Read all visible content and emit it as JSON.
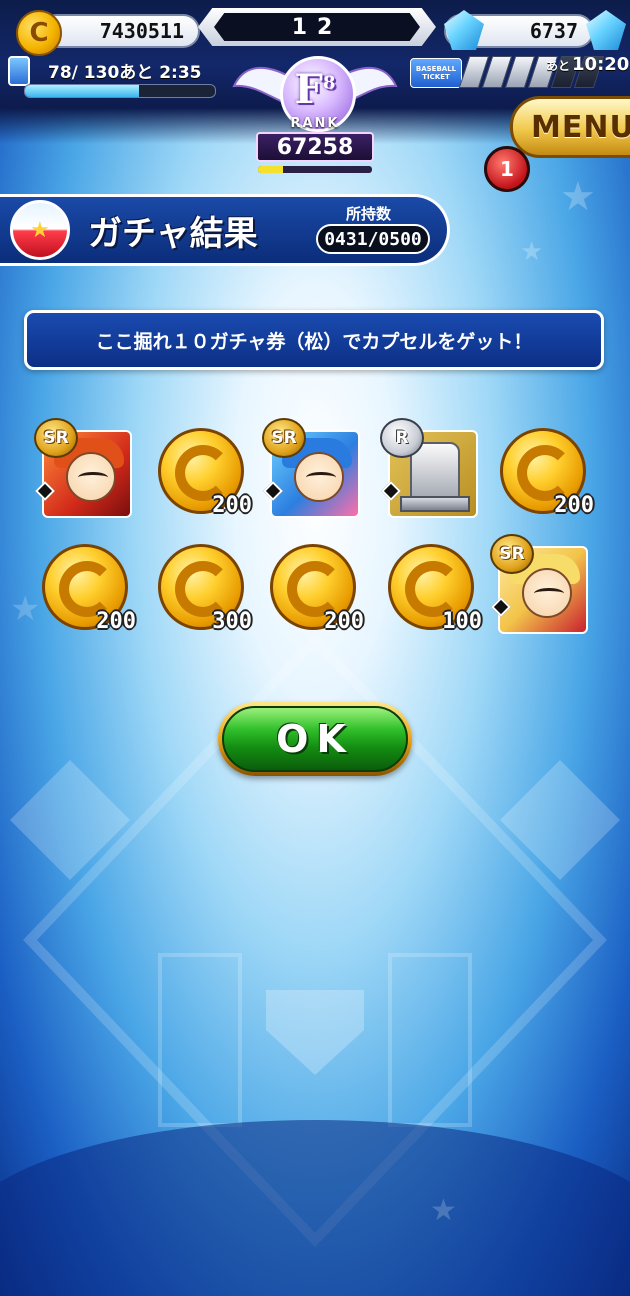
{
  "header": {
    "coins": "7430511",
    "level": "12",
    "gems": "6737",
    "stamina_text": "78/ 130あと 2:35",
    "stamina_fraction": 0.6,
    "ticket_label": "BASEBALL TICKET",
    "ticket_slots_filled": 4,
    "ticket_slots_total": 6,
    "ticket_prefix": "あと",
    "ticket_time": "10:20",
    "rank_letter": "F",
    "rank_sub": "8",
    "rank_word": "RANK",
    "rank_value": "67258",
    "rank_progress": 0.22,
    "menu_label": "MENU",
    "notification_count": "1"
  },
  "title_banner": {
    "title": "ガチャ結果",
    "owned_label": "所持数",
    "owned_value": "0431/0500"
  },
  "message": "ここ掘れ１０ガチャ券（松）でカプセルをゲット！",
  "results": [
    {
      "kind": "card",
      "rarity": "SR",
      "style": "red"
    },
    {
      "kind": "coin",
      "amount": "200"
    },
    {
      "kind": "card",
      "rarity": "SR",
      "style": "blue"
    },
    {
      "kind": "card",
      "rarity": "R",
      "style": "silver"
    },
    {
      "kind": "coin",
      "amount": "200"
    },
    {
      "kind": "coin",
      "amount": "200"
    },
    {
      "kind": "coin",
      "amount": "300"
    },
    {
      "kind": "coin",
      "amount": "200"
    },
    {
      "kind": "coin",
      "amount": "100"
    },
    {
      "kind": "card",
      "rarity": "SR",
      "style": "yellow"
    }
  ],
  "ok_label": "OK",
  "colors": {
    "accent_blue": "#0c2f86",
    "gold": "#f1c84a",
    "ok_green": "#2fbf2a"
  }
}
